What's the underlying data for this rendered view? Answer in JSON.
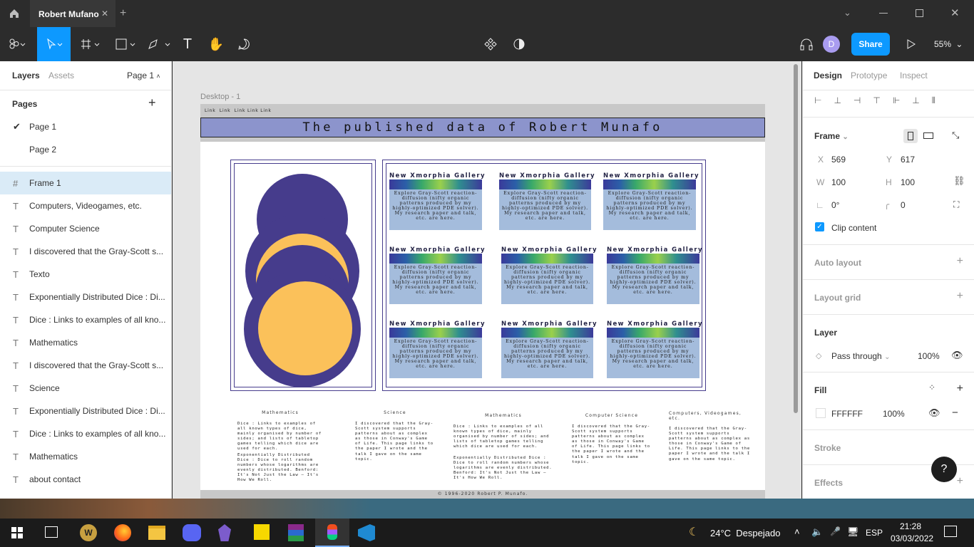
{
  "app": {
    "tab_title": "Robert Mufano",
    "zoom": "55%",
    "share_label": "Share",
    "avatar_initial": "D"
  },
  "left_panel": {
    "tabs": [
      "Layers",
      "Assets"
    ],
    "page_selector": "Page 1",
    "pages_heading": "Pages",
    "pages": [
      "Page 1",
      "Page 2"
    ],
    "layers": [
      "Frame 1",
      "Computers, Videogames, etc.",
      "Computer Science",
      "I discovered that the Gray-Scott s...",
      "Texto",
      "Exponentially Distributed Dice : Di...",
      "Dice : Links to examples of all kno...",
      "Mathematics",
      "I discovered that the Gray-Scott s...",
      "Science",
      "Exponentially Distributed Dice : Di...",
      "Dice : Links to examples of all kno...",
      "Mathematics",
      "about     contact"
    ]
  },
  "canvas": {
    "frame_label": "Desktop - 1",
    "nav_links": "Link  Link  Link Link Link",
    "header_title": "The published data of Robert Munafo",
    "card_title": "New Xmorphia Gallery",
    "card_text": "Explore Gray-Scott reaction-diffusion (nifty organic patterns produced by my highly-optimized PDE solver). My research paper and talk, etc. are here.",
    "columns": [
      {
        "heading": "Mathematics",
        "text1": "Dice : Links to examples of all known types of dice, mainly organised by number of sides; and lists of tabletop games telling which dice are used for each.",
        "text2": "Exponentially Distributed Dice : Dice to roll random numbers whose logarithms are evenly distributed. Benford: It's Not Just the Law — It's How We Roll."
      },
      {
        "heading": "Science",
        "text1": "I discovered that the Gray-Scott system supports patterns about as complex as those in Conway's Game of Life. This page links to the paper I wrote and the talk I gave on the same topic.",
        "text2": ""
      },
      {
        "heading": "Mathematics",
        "text1": "Dice : Links to examples of all known types of dice, mainly organised by number of sides; and lists of tabletop games telling which dice are used for each.",
        "text2": "Exponentially Distributed Dice : Dice to roll random numbers whose logarithms are evenly distributed. Benford: It's Not Just the Law — It's How We Roll."
      },
      {
        "heading": "Computer Science",
        "text1": "I discovered that the Gray-Scott system supports patterns about as complex as those in Conway's Game of Life. This page links to the paper I wrote and the talk I gave on the same topic.",
        "text2": ""
      },
      {
        "heading": "Computers, Videogames, etc.",
        "text1": "I discovered that the Gray-Scott system supports patterns about as complex as those in Conway's Game of Life. This page links to the paper I wrote and the talk I gave on the same topic.",
        "text2": ""
      }
    ],
    "footer": "© 1996-2020 Robert P. Munafo."
  },
  "right_panel": {
    "tabs": [
      "Design",
      "Prototype",
      "Inspect"
    ],
    "frame_label": "Frame",
    "x_label": "X",
    "x": "569",
    "y_label": "Y",
    "y": "617",
    "w_label": "W",
    "w": "100",
    "h_label": "H",
    "h": "100",
    "rotation": "0°",
    "radius": "0",
    "clip_content": "Clip content",
    "auto_layout": "Auto layout",
    "layout_grid": "Layout grid",
    "layer_heading": "Layer",
    "blend_mode": "Pass through",
    "layer_opacity": "100%",
    "fill_heading": "Fill",
    "fill_hex": "FFFFFF",
    "fill_opacity": "100%",
    "stroke": "Stroke",
    "effects": "Effects"
  },
  "taskbar": {
    "weather": "24°C  Despejado",
    "lang": "ESP",
    "time": "21:28",
    "date": "03/03/2022"
  },
  "colors": {
    "accent": "#0d99ff",
    "banner": "#8c94cc",
    "circle_dark": "#463c8c",
    "circle_light": "#fbc15a",
    "card_bg": "#a4bcdc"
  }
}
